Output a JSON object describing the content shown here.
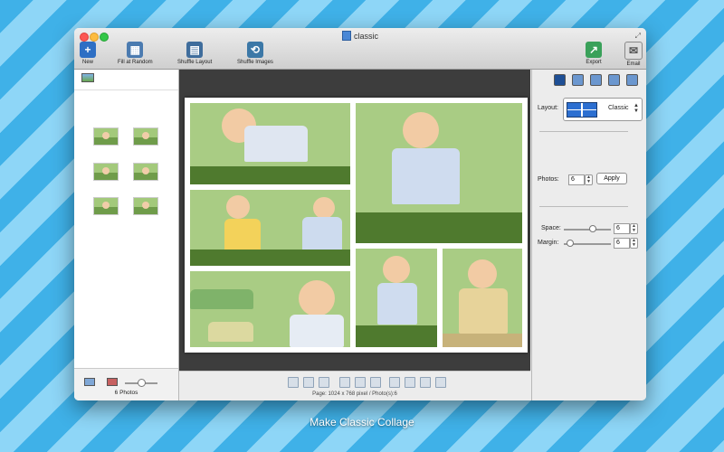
{
  "window": {
    "title": "classic"
  },
  "toolbar": {
    "new_label": "New",
    "fill_random_label": "Fill at Random",
    "shuffle_layout_label": "Shuffle Layout",
    "shuffle_images_label": "Shuffle Images",
    "export_label": "Export",
    "email_label": "Email"
  },
  "left_panel": {
    "photo_count": "6 Photos",
    "thumbnail_count": 6
  },
  "right_panel": {
    "layout_label": "Layout:",
    "layout_value": "Classic",
    "photos_label": "Photos:",
    "photos_value": "6",
    "apply_label": "Apply",
    "space_label": "Space:",
    "space_value": "6",
    "margin_label": "Margin:",
    "margin_value": "6"
  },
  "status": {
    "text": "Page: 1024 x 768 pixel / Photo(s):6"
  },
  "caption": "Make Classic Collage",
  "colors": {
    "accent": "#2e6fc4",
    "background_stripe_a": "#3fb1e8",
    "background_stripe_b": "#8ed6f7",
    "canvas": "#3d3d3d"
  }
}
